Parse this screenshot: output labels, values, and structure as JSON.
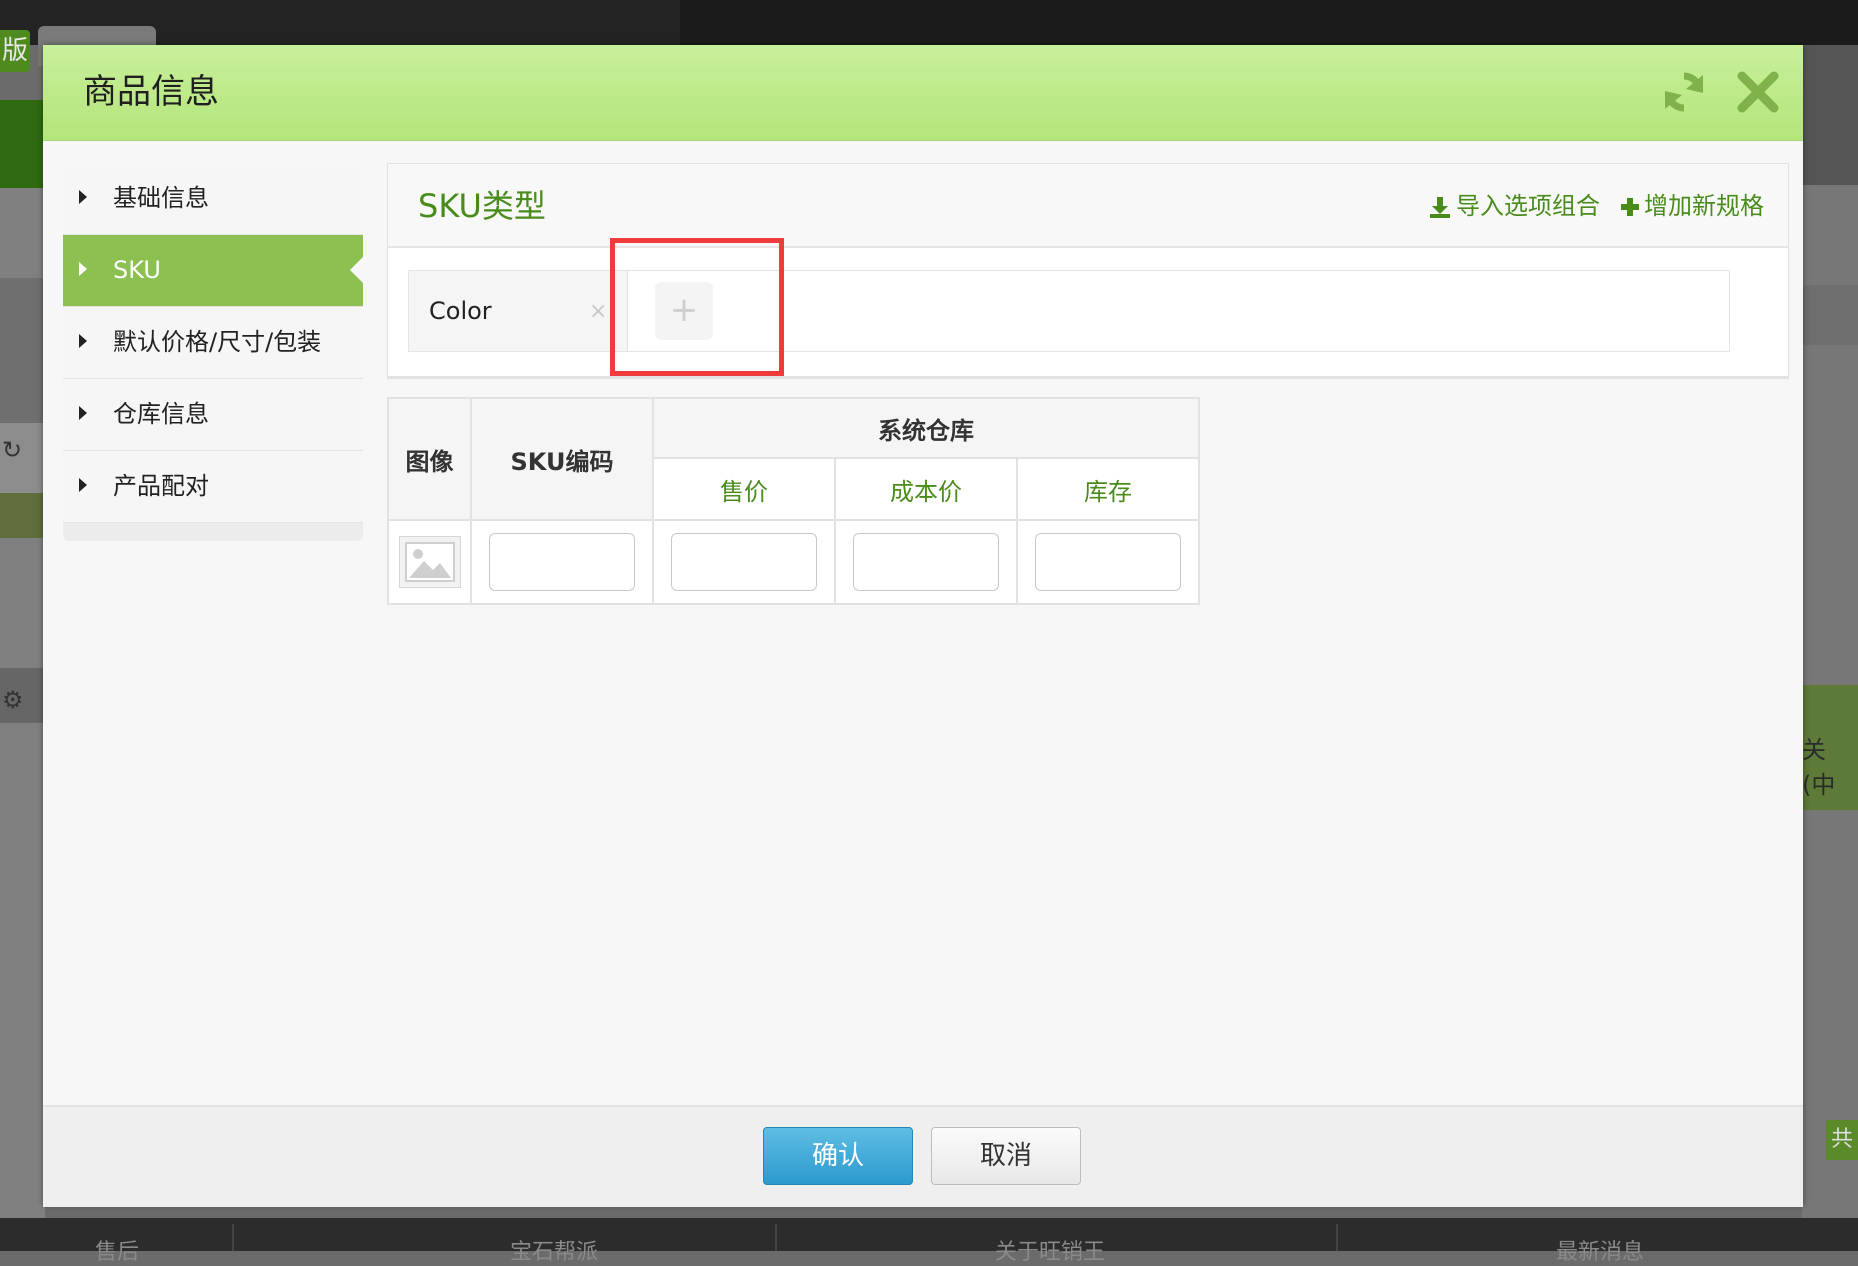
{
  "background": {
    "corner_tab_text": "版",
    "right_text": "关(中",
    "right_button": "共",
    "bottom_items": [
      "售后",
      "宝石帮派",
      "关于旺销王",
      "最新消息"
    ]
  },
  "modal": {
    "title": "商品信息",
    "header_icons": [
      "refresh-icon",
      "close-icon"
    ]
  },
  "sidebar": {
    "items": [
      {
        "label": "基础信息",
        "active": false
      },
      {
        "label": "SKU",
        "active": true
      },
      {
        "label": "默认价格/尺寸/包装",
        "active": false
      },
      {
        "label": "仓库信息",
        "active": false
      },
      {
        "label": "产品配对",
        "active": false
      }
    ]
  },
  "sku_type": {
    "title": "SKU类型",
    "import_label": "导入选项组合",
    "add_spec_label": "增加新规格",
    "spec_name": "Color",
    "remove_glyph": "×",
    "add_glyph": "+"
  },
  "sku_table": {
    "headers": {
      "image": "图像",
      "sku_code": "SKU编码",
      "warehouse": "系统仓库",
      "price": "售价",
      "cost": "成本价",
      "stock": "库存"
    },
    "row": {
      "sku_code": "",
      "price": "",
      "cost": "",
      "stock": ""
    }
  },
  "footer": {
    "confirm_label": "确认",
    "cancel_label": "取消"
  },
  "colors": {
    "accent_green": "#8cc152",
    "header_green": "#b4e57a",
    "link_green": "#4a8c1c",
    "confirm_blue": "#2b9acf",
    "highlight_red": "#ef3b3b"
  }
}
